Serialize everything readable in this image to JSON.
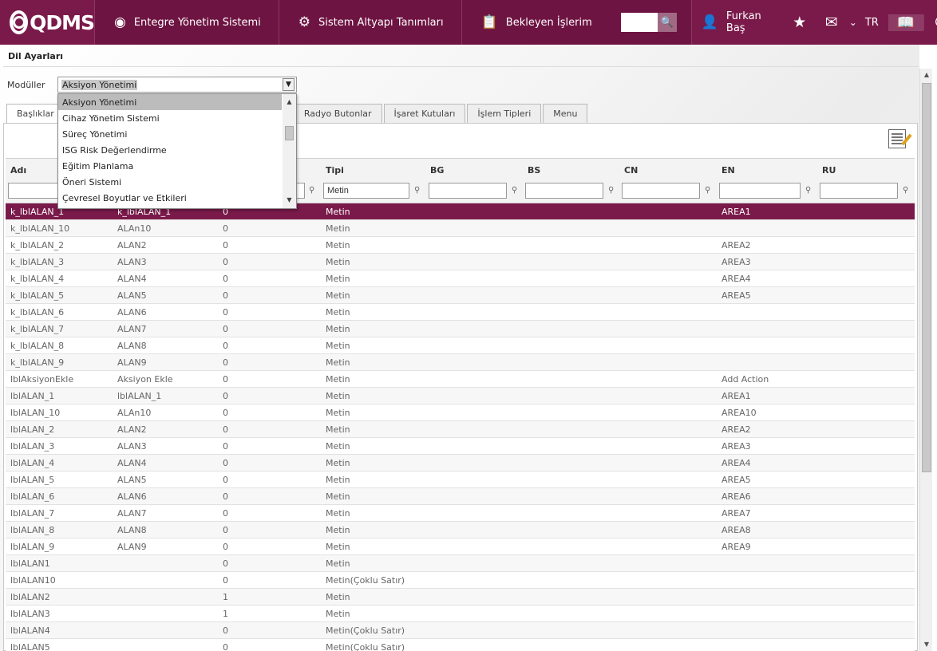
{
  "topbar": {
    "logo": "QDMS",
    "nav": [
      {
        "label": "Entegre Yönetim Sistemi",
        "icon": "q-circle-icon"
      },
      {
        "label": "Sistem Altyapı Tanımları",
        "icon": "gear-icon"
      },
      {
        "label": "Bekleyen İşlerim",
        "icon": "clipboard-icon"
      }
    ],
    "search_value": "",
    "user_name": "Furkan Baş",
    "language": "TR"
  },
  "page": {
    "title": "Dil Ayarları",
    "modules_label": "Modüller",
    "module_selected": "Aksiyon Yönetimi",
    "module_options": [
      "Aksiyon Yönetimi",
      "Cihaz Yönetim Sistemi",
      "Süreç Yönetimi",
      "ISG Risk Değerlendirme",
      "Eğitim Planlama",
      "Öneri Sistemi",
      "Çevresel Boyutlar ve Etkileri"
    ],
    "tabs": [
      "Başlıklar",
      "Radyo Butonlar",
      "İşaret Kutuları",
      "İşlem Tipleri",
      "Menu"
    ]
  },
  "grid": {
    "columns": [
      "Adı",
      "",
      "",
      "Tipi",
      "BG",
      "BS",
      "CN",
      "EN",
      "RU"
    ],
    "filters": {
      "tipi": "Metin"
    },
    "rows": [
      [
        "k_lblALAN_1",
        "k_lblALAN_1",
        "0",
        "Metin",
        "AREA1"
      ],
      [
        "k_lblALAN_10",
        "ALAn10",
        "0",
        "Metin",
        ""
      ],
      [
        "k_lblALAN_2",
        "ALAN2",
        "0",
        "Metin",
        "AREA2"
      ],
      [
        "k_lblALAN_3",
        "ALAN3",
        "0",
        "Metin",
        "AREA3"
      ],
      [
        "k_lblALAN_4",
        "ALAN4",
        "0",
        "Metin",
        "AREA4"
      ],
      [
        "k_lblALAN_5",
        "ALAN5",
        "0",
        "Metin",
        "AREA5"
      ],
      [
        "k_lblALAN_6",
        "ALAN6",
        "0",
        "Metin",
        ""
      ],
      [
        "k_lblALAN_7",
        "ALAN7",
        "0",
        "Metin",
        ""
      ],
      [
        "k_lblALAN_8",
        "ALAN8",
        "0",
        "Metin",
        ""
      ],
      [
        "k_lblALAN_9",
        "ALAN9",
        "0",
        "Metin",
        ""
      ],
      [
        "lblAksiyonEkle",
        "Aksiyon Ekle",
        "0",
        "Metin",
        "Add Action"
      ],
      [
        "lblALAN_1",
        "lblALAN_1",
        "0",
        "Metin",
        "AREA1"
      ],
      [
        "lblALAN_10",
        "ALAn10",
        "0",
        "Metin",
        "AREA10"
      ],
      [
        "lblALAN_2",
        "ALAN2",
        "0",
        "Metin",
        "AREA2"
      ],
      [
        "lblALAN_3",
        "ALAN3",
        "0",
        "Metin",
        "AREA3"
      ],
      [
        "lblALAN_4",
        "ALAN4",
        "0",
        "Metin",
        "AREA4"
      ],
      [
        "lblALAN_5",
        "ALAN5",
        "0",
        "Metin",
        "AREA5"
      ],
      [
        "lblALAN_6",
        "ALAN6",
        "0",
        "Metin",
        "AREA6"
      ],
      [
        "lblALAN_7",
        "ALAN7",
        "0",
        "Metin",
        "AREA7"
      ],
      [
        "lblALAN_8",
        "ALAN8",
        "0",
        "Metin",
        "AREA8"
      ],
      [
        "lblALAN_9",
        "ALAN9",
        "0",
        "Metin",
        "AREA9"
      ],
      [
        "lblALAN1",
        "",
        "0",
        "Metin",
        ""
      ],
      [
        "lblALAN10",
        "",
        "0",
        "Metin(Çoklu Satır)",
        ""
      ],
      [
        "lblALAN2",
        "",
        "1",
        "Metin",
        ""
      ],
      [
        "lblALAN3",
        "",
        "1",
        "Metin",
        ""
      ],
      [
        "lblALAN4",
        "",
        "0",
        "Metin(Çoklu Satır)",
        ""
      ],
      [
        "lblALAN5",
        "",
        "0",
        "Metin(Çoklu Satır)",
        ""
      ]
    ]
  },
  "colors": {
    "brand": "#7a1a4a",
    "selected_row": "#7a1a4a"
  }
}
